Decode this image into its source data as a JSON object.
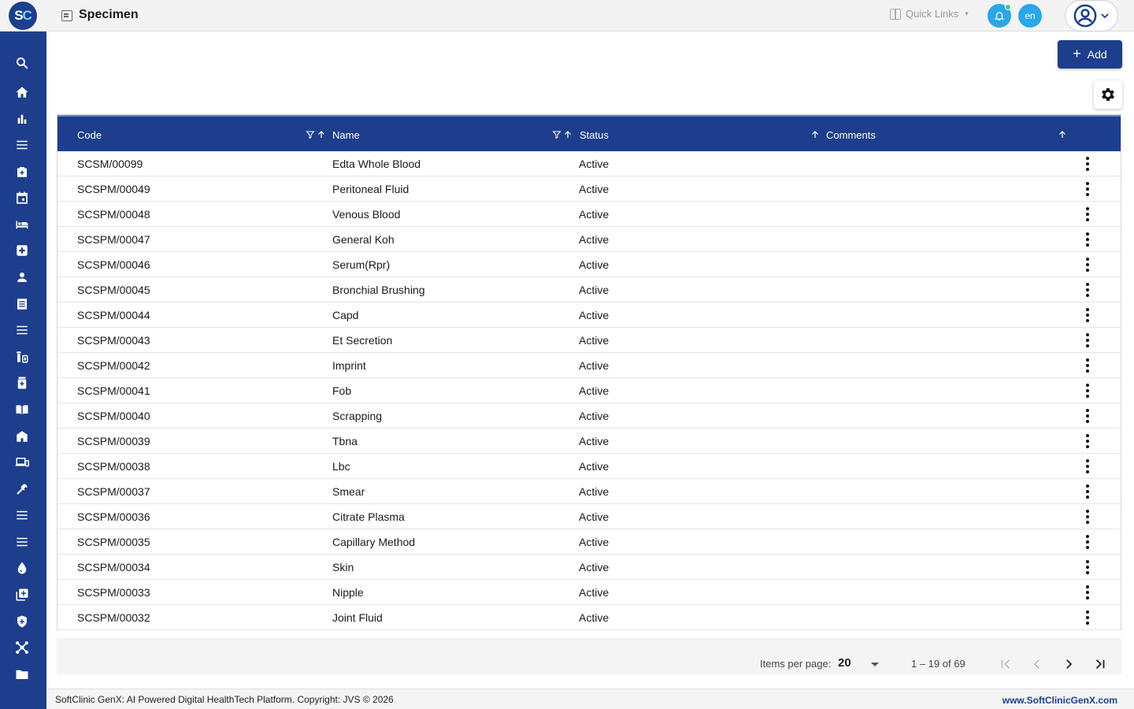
{
  "app": {
    "logo_s": "S",
    "logo_c": "C",
    "page_title": "Specimen"
  },
  "header": {
    "quick_links_label": "Quick Links",
    "language": "en"
  },
  "toolbar": {
    "add_label": "Add"
  },
  "table": {
    "columns": [
      "Code",
      "Name",
      "Status",
      "Comments"
    ],
    "rows": [
      {
        "code": "SCSM/00099",
        "name": "Edta Whole Blood",
        "status": "Active",
        "comments": ""
      },
      {
        "code": "SCSPM/00049",
        "name": "Peritoneal Fluid",
        "status": "Active",
        "comments": ""
      },
      {
        "code": "SCSPM/00048",
        "name": "Venous Blood",
        "status": "Active",
        "comments": ""
      },
      {
        "code": "SCSPM/00047",
        "name": "General Koh",
        "status": "Active",
        "comments": ""
      },
      {
        "code": "SCSPM/00046",
        "name": "Serum(Rpr)",
        "status": "Active",
        "comments": ""
      },
      {
        "code": "SCSPM/00045",
        "name": "Bronchial Brushing",
        "status": "Active",
        "comments": ""
      },
      {
        "code": "SCSPM/00044",
        "name": "Capd",
        "status": "Active",
        "comments": ""
      },
      {
        "code": "SCSPM/00043",
        "name": "Et Secretion",
        "status": "Active",
        "comments": ""
      },
      {
        "code": "SCSPM/00042",
        "name": "Imprint",
        "status": "Active",
        "comments": ""
      },
      {
        "code": "SCSPM/00041",
        "name": "Fob",
        "status": "Active",
        "comments": ""
      },
      {
        "code": "SCSPM/00040",
        "name": "Scrapping",
        "status": "Active",
        "comments": ""
      },
      {
        "code": "SCSPM/00039",
        "name": "Tbna",
        "status": "Active",
        "comments": ""
      },
      {
        "code": "SCSPM/00038",
        "name": "Lbc",
        "status": "Active",
        "comments": ""
      },
      {
        "code": "SCSPM/00037",
        "name": "Smear",
        "status": "Active",
        "comments": ""
      },
      {
        "code": "SCSPM/00036",
        "name": "Citrate Plasma",
        "status": "Active",
        "comments": ""
      },
      {
        "code": "SCSPM/00035",
        "name": "Capillary Method",
        "status": "Active",
        "comments": ""
      },
      {
        "code": "SCSPM/00034",
        "name": "Skin",
        "status": "Active",
        "comments": ""
      },
      {
        "code": "SCSPM/00033",
        "name": "Nipple",
        "status": "Active",
        "comments": ""
      },
      {
        "code": "SCSPM/00032",
        "name": "Joint Fluid",
        "status": "Active",
        "comments": ""
      }
    ]
  },
  "pagination": {
    "items_per_page_label": "Items per page:",
    "items_per_page": "20",
    "range": "1 – 19 of 69"
  },
  "footer": {
    "copyright": "SoftClinic GenX: AI Powered Digital HealthTech Platform. Copyright: JVS © 2026",
    "website": "www.SoftClinicGenX.com"
  },
  "sidebar": {
    "items": [
      "search-icon",
      "home-icon",
      "bar-chart-icon",
      "menu-icon",
      "medical-bag-icon",
      "calendar-icon",
      "bed-icon",
      "medical-plus-icon",
      "person-icon",
      "receipt-icon",
      "menu-icon",
      "pharmacy-icon",
      "medicine-icon",
      "book-icon",
      "store-icon",
      "devices-icon",
      "wrench-icon",
      "menu-icon",
      "menu-icon",
      "blood-drop-icon",
      "add-box-icon",
      "shield-icon",
      "hub-icon",
      "folder-icon"
    ]
  },
  "colors": {
    "primary": "#1d3e8c",
    "accent": "#2ba6e8",
    "notification_dot": "#38d07a"
  }
}
